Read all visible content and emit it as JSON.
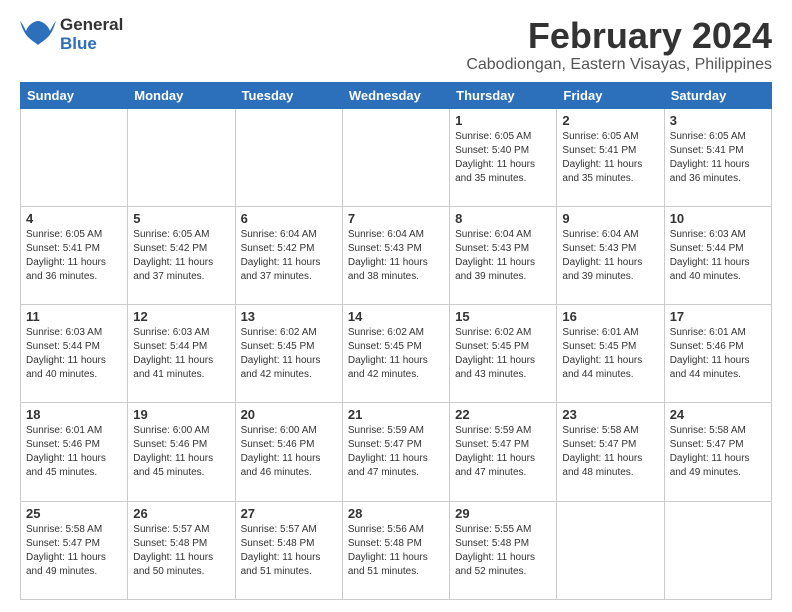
{
  "logo": {
    "general": "General",
    "blue": "Blue"
  },
  "title": "February 2024",
  "location": "Cabodiongan, Eastern Visayas, Philippines",
  "days_header": [
    "Sunday",
    "Monday",
    "Tuesday",
    "Wednesday",
    "Thursday",
    "Friday",
    "Saturday"
  ],
  "weeks": [
    [
      {
        "day": "",
        "sunrise": "",
        "sunset": "",
        "daylight": ""
      },
      {
        "day": "",
        "sunrise": "",
        "sunset": "",
        "daylight": ""
      },
      {
        "day": "",
        "sunrise": "",
        "sunset": "",
        "daylight": ""
      },
      {
        "day": "",
        "sunrise": "",
        "sunset": "",
        "daylight": ""
      },
      {
        "day": "1",
        "sunrise": "Sunrise: 6:05 AM",
        "sunset": "Sunset: 5:40 PM",
        "daylight": "Daylight: 11 hours and 35 minutes."
      },
      {
        "day": "2",
        "sunrise": "Sunrise: 6:05 AM",
        "sunset": "Sunset: 5:41 PM",
        "daylight": "Daylight: 11 hours and 35 minutes."
      },
      {
        "day": "3",
        "sunrise": "Sunrise: 6:05 AM",
        "sunset": "Sunset: 5:41 PM",
        "daylight": "Daylight: 11 hours and 36 minutes."
      }
    ],
    [
      {
        "day": "4",
        "sunrise": "Sunrise: 6:05 AM",
        "sunset": "Sunset: 5:41 PM",
        "daylight": "Daylight: 11 hours and 36 minutes."
      },
      {
        "day": "5",
        "sunrise": "Sunrise: 6:05 AM",
        "sunset": "Sunset: 5:42 PM",
        "daylight": "Daylight: 11 hours and 37 minutes."
      },
      {
        "day": "6",
        "sunrise": "Sunrise: 6:04 AM",
        "sunset": "Sunset: 5:42 PM",
        "daylight": "Daylight: 11 hours and 37 minutes."
      },
      {
        "day": "7",
        "sunrise": "Sunrise: 6:04 AM",
        "sunset": "Sunset: 5:43 PM",
        "daylight": "Daylight: 11 hours and 38 minutes."
      },
      {
        "day": "8",
        "sunrise": "Sunrise: 6:04 AM",
        "sunset": "Sunset: 5:43 PM",
        "daylight": "Daylight: 11 hours and 39 minutes."
      },
      {
        "day": "9",
        "sunrise": "Sunrise: 6:04 AM",
        "sunset": "Sunset: 5:43 PM",
        "daylight": "Daylight: 11 hours and 39 minutes."
      },
      {
        "day": "10",
        "sunrise": "Sunrise: 6:03 AM",
        "sunset": "Sunset: 5:44 PM",
        "daylight": "Daylight: 11 hours and 40 minutes."
      }
    ],
    [
      {
        "day": "11",
        "sunrise": "Sunrise: 6:03 AM",
        "sunset": "Sunset: 5:44 PM",
        "daylight": "Daylight: 11 hours and 40 minutes."
      },
      {
        "day": "12",
        "sunrise": "Sunrise: 6:03 AM",
        "sunset": "Sunset: 5:44 PM",
        "daylight": "Daylight: 11 hours and 41 minutes."
      },
      {
        "day": "13",
        "sunrise": "Sunrise: 6:02 AM",
        "sunset": "Sunset: 5:45 PM",
        "daylight": "Daylight: 11 hours and 42 minutes."
      },
      {
        "day": "14",
        "sunrise": "Sunrise: 6:02 AM",
        "sunset": "Sunset: 5:45 PM",
        "daylight": "Daylight: 11 hours and 42 minutes."
      },
      {
        "day": "15",
        "sunrise": "Sunrise: 6:02 AM",
        "sunset": "Sunset: 5:45 PM",
        "daylight": "Daylight: 11 hours and 43 minutes."
      },
      {
        "day": "16",
        "sunrise": "Sunrise: 6:01 AM",
        "sunset": "Sunset: 5:45 PM",
        "daylight": "Daylight: 11 hours and 44 minutes."
      },
      {
        "day": "17",
        "sunrise": "Sunrise: 6:01 AM",
        "sunset": "Sunset: 5:46 PM",
        "daylight": "Daylight: 11 hours and 44 minutes."
      }
    ],
    [
      {
        "day": "18",
        "sunrise": "Sunrise: 6:01 AM",
        "sunset": "Sunset: 5:46 PM",
        "daylight": "Daylight: 11 hours and 45 minutes."
      },
      {
        "day": "19",
        "sunrise": "Sunrise: 6:00 AM",
        "sunset": "Sunset: 5:46 PM",
        "daylight": "Daylight: 11 hours and 45 minutes."
      },
      {
        "day": "20",
        "sunrise": "Sunrise: 6:00 AM",
        "sunset": "Sunset: 5:46 PM",
        "daylight": "Daylight: 11 hours and 46 minutes."
      },
      {
        "day": "21",
        "sunrise": "Sunrise: 5:59 AM",
        "sunset": "Sunset: 5:47 PM",
        "daylight": "Daylight: 11 hours and 47 minutes."
      },
      {
        "day": "22",
        "sunrise": "Sunrise: 5:59 AM",
        "sunset": "Sunset: 5:47 PM",
        "daylight": "Daylight: 11 hours and 47 minutes."
      },
      {
        "day": "23",
        "sunrise": "Sunrise: 5:58 AM",
        "sunset": "Sunset: 5:47 PM",
        "daylight": "Daylight: 11 hours and 48 minutes."
      },
      {
        "day": "24",
        "sunrise": "Sunrise: 5:58 AM",
        "sunset": "Sunset: 5:47 PM",
        "daylight": "Daylight: 11 hours and 49 minutes."
      }
    ],
    [
      {
        "day": "25",
        "sunrise": "Sunrise: 5:58 AM",
        "sunset": "Sunset: 5:47 PM",
        "daylight": "Daylight: 11 hours and 49 minutes."
      },
      {
        "day": "26",
        "sunrise": "Sunrise: 5:57 AM",
        "sunset": "Sunset: 5:48 PM",
        "daylight": "Daylight: 11 hours and 50 minutes."
      },
      {
        "day": "27",
        "sunrise": "Sunrise: 5:57 AM",
        "sunset": "Sunset: 5:48 PM",
        "daylight": "Daylight: 11 hours and 51 minutes."
      },
      {
        "day": "28",
        "sunrise": "Sunrise: 5:56 AM",
        "sunset": "Sunset: 5:48 PM",
        "daylight": "Daylight: 11 hours and 51 minutes."
      },
      {
        "day": "29",
        "sunrise": "Sunrise: 5:55 AM",
        "sunset": "Sunset: 5:48 PM",
        "daylight": "Daylight: 11 hours and 52 minutes."
      },
      {
        "day": "",
        "sunrise": "",
        "sunset": "",
        "daylight": ""
      },
      {
        "day": "",
        "sunrise": "",
        "sunset": "",
        "daylight": ""
      }
    ]
  ]
}
